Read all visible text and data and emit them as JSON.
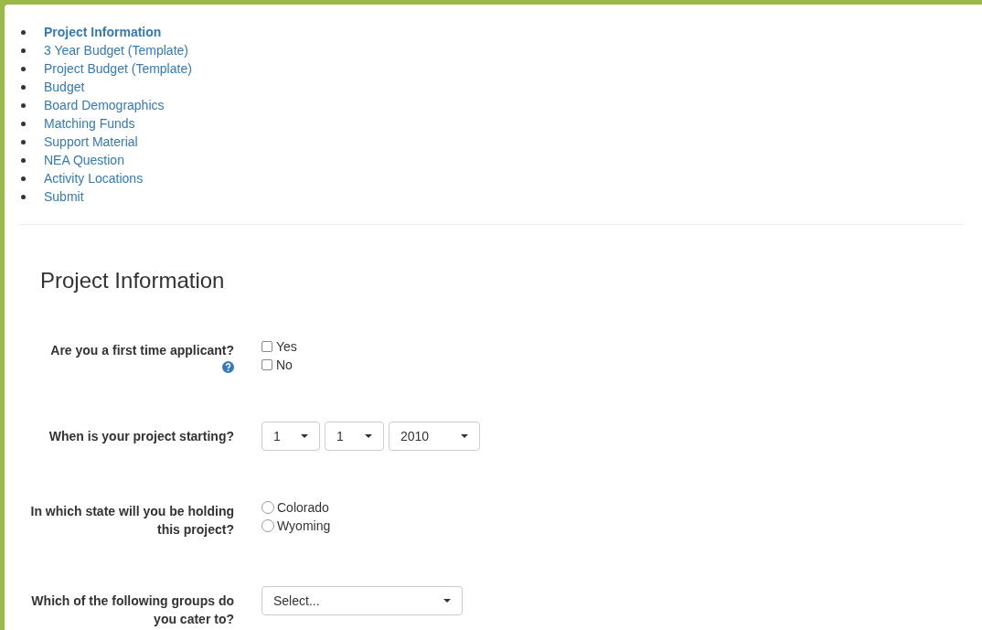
{
  "nav": [
    {
      "label": "Project Information",
      "selected": true
    },
    {
      "label": "3 Year Budget (Template)",
      "selected": false
    },
    {
      "label": "Project Budget (Template)",
      "selected": false
    },
    {
      "label": "Budget",
      "selected": false
    },
    {
      "label": "Board Demographics",
      "selected": false
    },
    {
      "label": "Matching Funds",
      "selected": false
    },
    {
      "label": "Support Material",
      "selected": false
    },
    {
      "label": "NEA Question",
      "selected": false
    },
    {
      "label": "Activity Locations",
      "selected": false
    },
    {
      "label": "Submit",
      "selected": false
    }
  ],
  "heading": "Project Information",
  "questions": [
    {
      "kind": "checkboxes",
      "label": "Are you a first time applicant?",
      "help": true,
      "options": [
        {
          "label": "Yes",
          "checked": false
        },
        {
          "label": "No",
          "checked": false
        }
      ]
    },
    {
      "kind": "dates",
      "label": "When is your project starting?",
      "help": false,
      "selects": [
        "1",
        "1",
        "2010"
      ]
    },
    {
      "kind": "radios",
      "label": "In which state will you be holding this project?",
      "help": false,
      "options": [
        {
          "label": "Colorado",
          "selected": false
        },
        {
          "label": "Wyoming",
          "selected": false
        }
      ]
    },
    {
      "kind": "select",
      "label": "Which of the following groups do you cater to?",
      "help": false,
      "value": "Select..."
    }
  ]
}
